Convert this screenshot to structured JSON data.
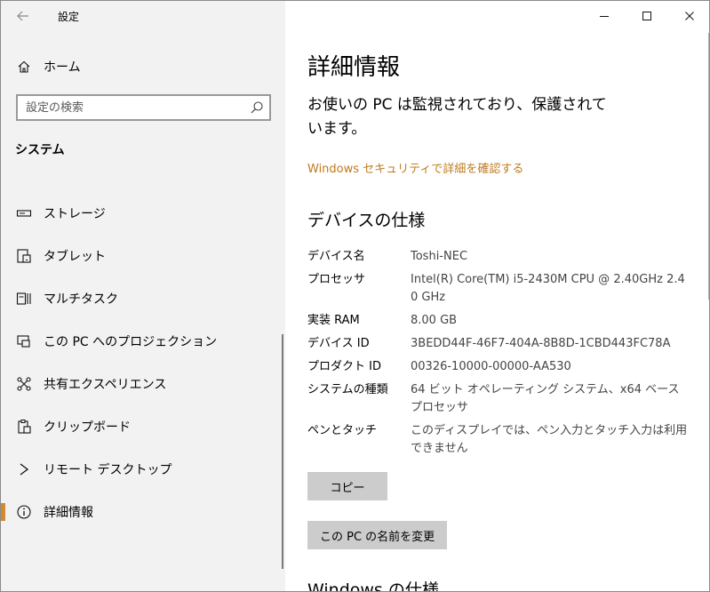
{
  "app": {
    "title": "設定"
  },
  "sidebar": {
    "home_label": "ホーム",
    "search_placeholder": "設定の検索",
    "section_title": "システム",
    "items": [
      {
        "label": "ストレージ",
        "icon": "storage-icon"
      },
      {
        "label": "タブレット",
        "icon": "tablet-icon"
      },
      {
        "label": "マルチタスク",
        "icon": "multitasking-icon"
      },
      {
        "label": "この PC へのプロジェクション",
        "icon": "projection-icon"
      },
      {
        "label": "共有エクスペリエンス",
        "icon": "shared-experiences-icon"
      },
      {
        "label": "クリップボード",
        "icon": "clipboard-icon"
      },
      {
        "label": "リモート デスクトップ",
        "icon": "remote-desktop-icon"
      },
      {
        "label": "詳細情報",
        "icon": "info-icon",
        "selected": true
      }
    ]
  },
  "main": {
    "title": "詳細情報",
    "protection_message": "お使いの PC は監視されており、保護されています。",
    "security_link": "Windows セキュリティで詳細を確認する",
    "device_specs_heading": "デバイスの仕様",
    "specs": [
      {
        "key": "デバイス名",
        "value": "Toshi-NEC"
      },
      {
        "key": "プロセッサ",
        "value": "Intel(R) Core(TM) i5-2430M CPU @ 2.40GHz   2.40 GHz"
      },
      {
        "key": "実装 RAM",
        "value": "8.00 GB"
      },
      {
        "key": "デバイス ID",
        "value": "3BEDD44F-46F7-404A-8B8D-1CBD443FC78A"
      },
      {
        "key": "プロダクト ID",
        "value": "00326-10000-00000-AA530"
      },
      {
        "key": "システムの種類",
        "value": "64 ビット オペレーティング システム、x64 ベース プロセッサ"
      },
      {
        "key": "ペンとタッチ",
        "value": "このディスプレイでは、ペン入力とタッチ入力は利用できません"
      }
    ],
    "copy_button": "コピー",
    "rename_button": "この PC の名前を変更",
    "windows_specs_heading": "Windows の仕様"
  },
  "colors": {
    "accent": "#d18a2f",
    "link": "#c07a1e",
    "sidebar_bg": "#f2f2f2",
    "button_bg": "#cccccc"
  }
}
